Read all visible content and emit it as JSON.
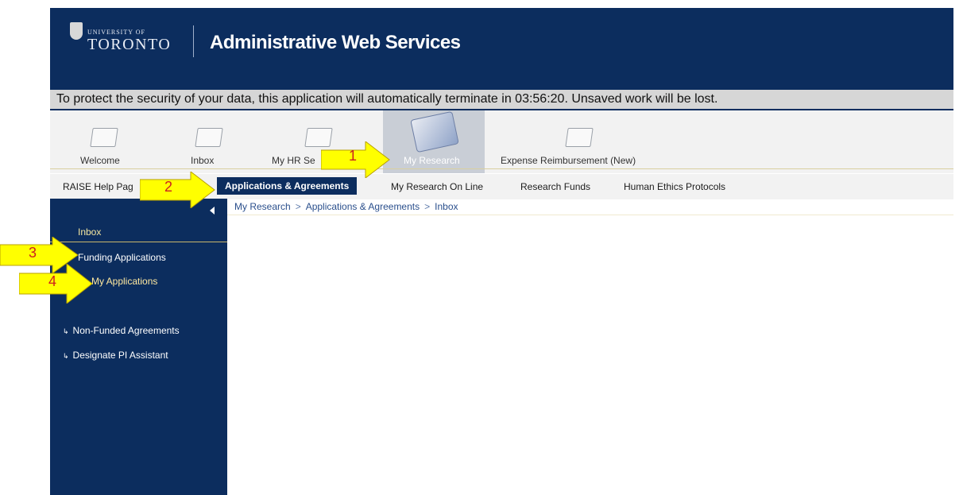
{
  "header": {
    "university_small": "UNIVERSITY OF",
    "university_big": "TORONTO",
    "title": "Administrative Web Services"
  },
  "timeout_message": "To protect the security of your data, this application will automatically terminate in 03:56:20. Unsaved work will be lost.",
  "tabs": [
    {
      "label": "Welcome"
    },
    {
      "label": "Inbox"
    },
    {
      "label": "My HR Se"
    },
    {
      "label": "My Research"
    },
    {
      "label": "Expense Reimbursement (New)"
    }
  ],
  "subtabs": [
    {
      "label": "RAISE Help Pag"
    },
    {
      "label": "Applications & Agreements"
    },
    {
      "label": "My Research On Line"
    },
    {
      "label": "Research Funds"
    },
    {
      "label": "Human Ethics Protocols"
    }
  ],
  "breadcrumb": [
    "My Research",
    "Applications & Agreements",
    "Inbox"
  ],
  "breadcrumb_separator": ">",
  "sidebar": {
    "inbox": "Inbox",
    "funding": "Funding Applications",
    "my_applications": "My Applications",
    "non_funded": "Non-Funded Agreements",
    "designate": "Designate PI Assistant"
  },
  "annotations": [
    "1",
    "2",
    "3",
    "4"
  ],
  "colors": {
    "navy": "#0c2d5e",
    "arrow_yellow": "#ffff00",
    "annotation_red": "#cc1f1f"
  }
}
